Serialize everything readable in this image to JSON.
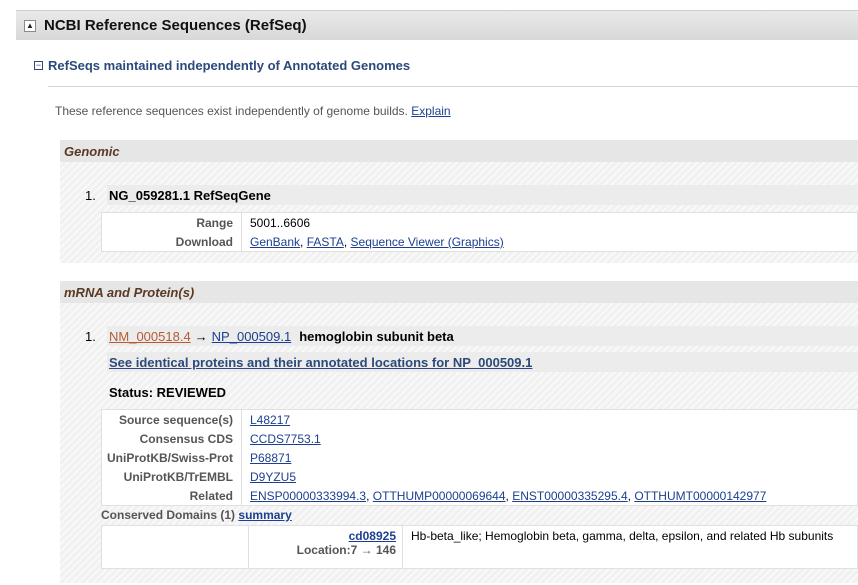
{
  "main": {
    "title": "NCBI Reference Sequences (RefSeq)",
    "collapse_glyph": "▲"
  },
  "subsection": {
    "title": "RefSeqs maintained independently of Annotated Genomes",
    "toggle_glyph": "−"
  },
  "intro": {
    "text": "These reference sequences exist independently of genome builds.",
    "link": "Explain"
  },
  "genomic": {
    "heading": "Genomic",
    "item_num": "1.",
    "item_title": "NG_059281.1 RefSeqGene",
    "range_label": "Range",
    "range_value": "5001..6606",
    "download_label": "Download",
    "download_links": [
      "GenBank",
      "FASTA",
      "Sequence Viewer (Graphics)"
    ]
  },
  "mrna": {
    "heading": "mRNA and Protein(s)",
    "item_num": "1.",
    "nm_link": "NM_000518.4",
    "arrow": "→",
    "np_link": "NP_000509.1",
    "name": "hemoglobin subunit beta",
    "see_identical": "See identical proteins and their annotated locations for NP_000509.1",
    "status": "Status: REVIEWED",
    "rows": [
      {
        "label": "Source sequence(s)",
        "links": [
          "L48217"
        ]
      },
      {
        "label": "Consensus CDS",
        "links": [
          "CCDS7753.1"
        ]
      },
      {
        "label": "UniProtKB/Swiss-Prot",
        "links": [
          "P68871"
        ]
      },
      {
        "label": "UniProtKB/TrEMBL",
        "links": [
          "D9YZU5"
        ]
      },
      {
        "label": "Related",
        "links": [
          "ENSP00000333994.3",
          "OTTHUMP00000069644",
          "ENST00000335295.4",
          "OTTHUMT00000142977"
        ]
      }
    ],
    "cd_label": "Conserved Domains (1)",
    "cd_summary_link": "summary",
    "cd_id": "cd08925",
    "cd_location": "Location:7 → 146",
    "cd_desc": "Hb-beta_like; Hemoglobin beta, gamma, delta, epsilon, and related Hb subunits"
  }
}
